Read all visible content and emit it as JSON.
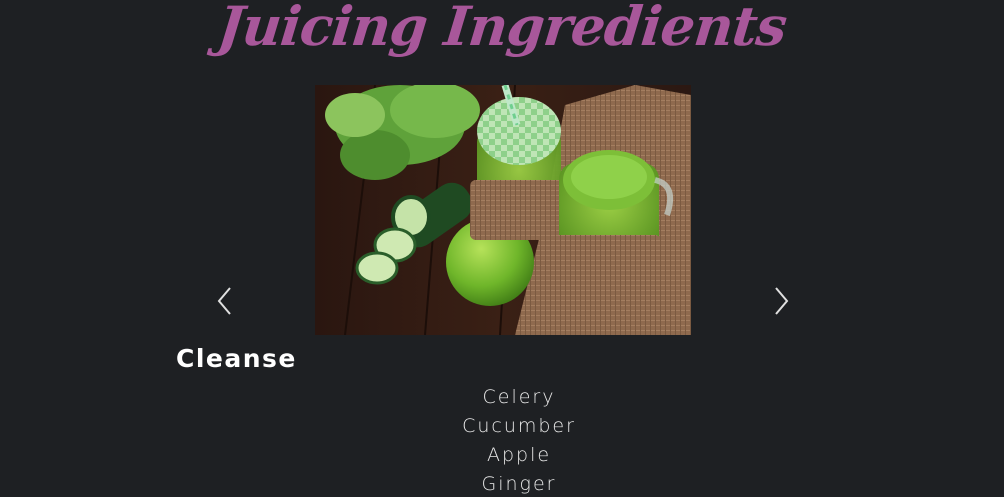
{
  "page": {
    "title": "Juicing Ingredients"
  },
  "carousel": {
    "prev_icon": "chevron-left-icon",
    "next_icon": "chevron-right-icon",
    "image_alt": "Green juice in mason jars with apple, cucumber and lettuce"
  },
  "section": {
    "heading": "Cleanse",
    "ingredients": [
      "Celery",
      "Cucumber",
      "Apple",
      "Ginger"
    ]
  },
  "colors": {
    "background": "#1e2023",
    "title": "#a8579a",
    "heading": "#ffffff",
    "text": "#e8e8e8"
  }
}
